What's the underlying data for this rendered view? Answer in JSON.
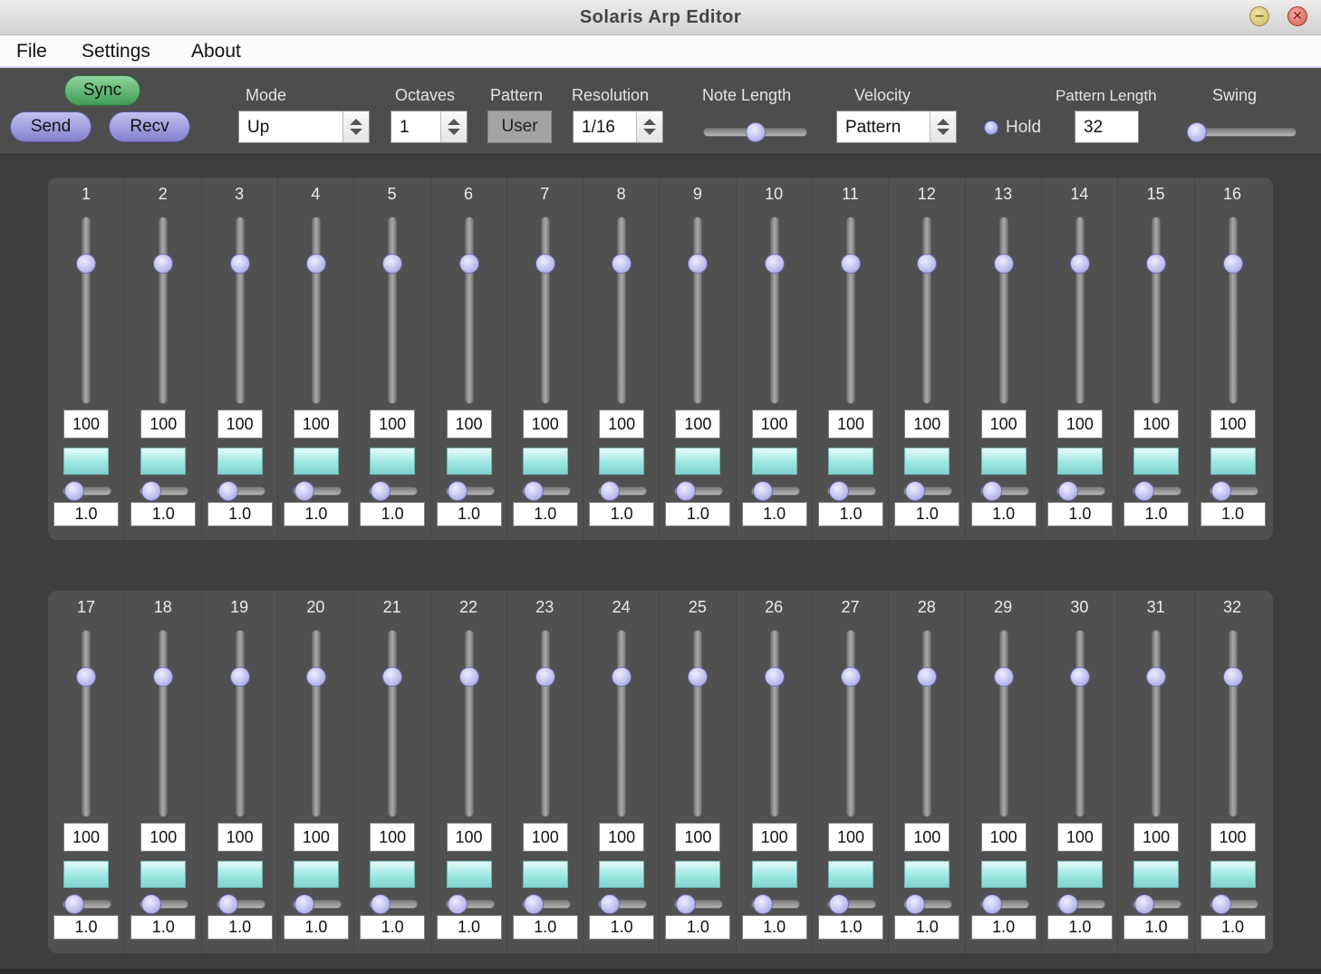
{
  "window": {
    "title": "Solaris Arp Editor",
    "minimize_symbol": "−",
    "close_symbol": "✕"
  },
  "menu": {
    "items": [
      "File",
      "Settings",
      "About"
    ]
  },
  "toolbar": {
    "sync_label": "Sync",
    "send_label": "Send",
    "recv_label": "Recv",
    "mode": {
      "label": "Mode",
      "value": "Up"
    },
    "octaves": {
      "label": "Octaves",
      "value": "1"
    },
    "pattern": {
      "label": "Pattern",
      "value": "User"
    },
    "resolution": {
      "label": "Resolution",
      "value": "1/16"
    },
    "note_length": {
      "label": "Note Length",
      "level": 0.5
    },
    "velocity": {
      "label": "Velocity",
      "value": "Pattern"
    },
    "hold": {
      "label": "Hold"
    },
    "pattern_length": {
      "label": "Pattern Length",
      "value": "32"
    },
    "swing": {
      "label": "Swing",
      "level": 0.0
    }
  },
  "steps": {
    "row1": [
      "1",
      "2",
      "3",
      "4",
      "5",
      "6",
      "7",
      "8",
      "9",
      "10",
      "11",
      "12",
      "13",
      "14",
      "15",
      "16"
    ],
    "row2": [
      "17",
      "18",
      "19",
      "20",
      "21",
      "22",
      "23",
      "24",
      "25",
      "26",
      "27",
      "28",
      "29",
      "30",
      "31",
      "32"
    ],
    "velocity_value": "100",
    "velocity_level": 0.78,
    "length_value": "1.0",
    "length_level": 0.0
  },
  "colors": {
    "background": "#3f3f3f",
    "panel": "#505050",
    "sync_green": "#3e9b56",
    "button_purple": "#8480cf",
    "gate_cyan": "#9ee7e2"
  }
}
